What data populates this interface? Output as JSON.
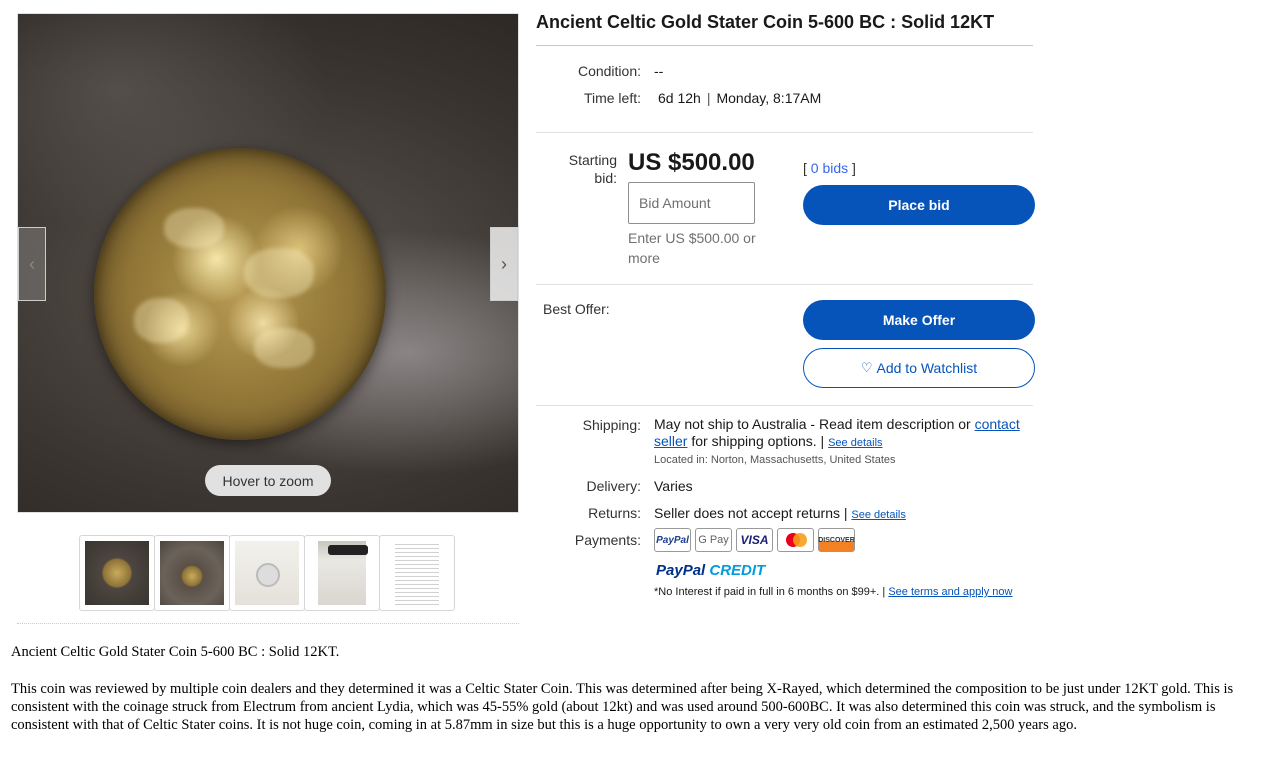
{
  "gallery": {
    "zoom_hint": "Hover to zoom",
    "prev_icon": "chevron-left-icon",
    "next_icon": "chevron-right-icon",
    "thumbnails": [
      "coin-front",
      "coin-on-stand",
      "coin-holder",
      "certificate",
      "document"
    ]
  },
  "item": {
    "title": "Ancient Celtic Gold Stater Coin 5-600 BC : Solid 12KT",
    "condition_label": "Condition:",
    "condition_value": "--",
    "time_left_label": "Time left:",
    "time_left_value": "6d 12h",
    "time_left_sep": "|",
    "time_left_end": "Monday, 8:17AM"
  },
  "bid": {
    "starting_label": "Starting bid:",
    "price": "US $500.00",
    "input_placeholder": "Bid Amount",
    "hint": "Enter US $500.00 or more",
    "bids_open": "[",
    "bids_link": "0 bids",
    "bids_close": "]",
    "place_bid": "Place bid"
  },
  "offer": {
    "label": "Best Offer:",
    "make_offer": "Make Offer",
    "watchlist": "Add to Watchlist",
    "watchlist_icon": "heart-icon"
  },
  "shipping": {
    "label": "Shipping:",
    "text": "May not ship to Australia - Read item description or",
    "contact_link": "contact seller",
    "text_after": "for shipping options. |",
    "see_details": "See details",
    "location": "Located in:  Norton, Massachusetts, United States"
  },
  "delivery": {
    "label": "Delivery:",
    "value": "Varies"
  },
  "returns": {
    "label": "Returns:",
    "value": "Seller does not accept returns |",
    "see_details": "See details"
  },
  "payments": {
    "label": "Payments:",
    "methods": [
      "PayPal",
      "G Pay",
      "VISA",
      "MasterCard",
      "DISCOVER"
    ],
    "paypal_credit_pp": "PayPal",
    "paypal_credit_cr": "CREDIT",
    "note": "*No Interest if paid in full in 6 months on $99+. |",
    "note_link": "See terms and apply now"
  },
  "description": {
    "line1": "Ancient Celtic Gold Stater Coin 5-600 BC : Solid 12KT.",
    "para": "This coin was reviewed by multiple coin dealers and they determined it was a Celtic Stater Coin.  This was determined after being X-Rayed, which determined the composition to be just under 12KT gold.  This is consistent with the coinage struck from Electrum from ancient Lydia, which was 45-55% gold (about 12kt) and was used around 500-600BC.  It was also determined this coin was struck, and the symbolism is consistent with that of Celtic Stater coins.  It is not huge coin, coming in at 5.87mm in size but this is a huge  opportunity to own a very very old coin from an estimated 2,500 years ago."
  },
  "colors": {
    "primary_button": "#0654ba",
    "link": "#0654ba",
    "bids_link": "#3665f3"
  }
}
